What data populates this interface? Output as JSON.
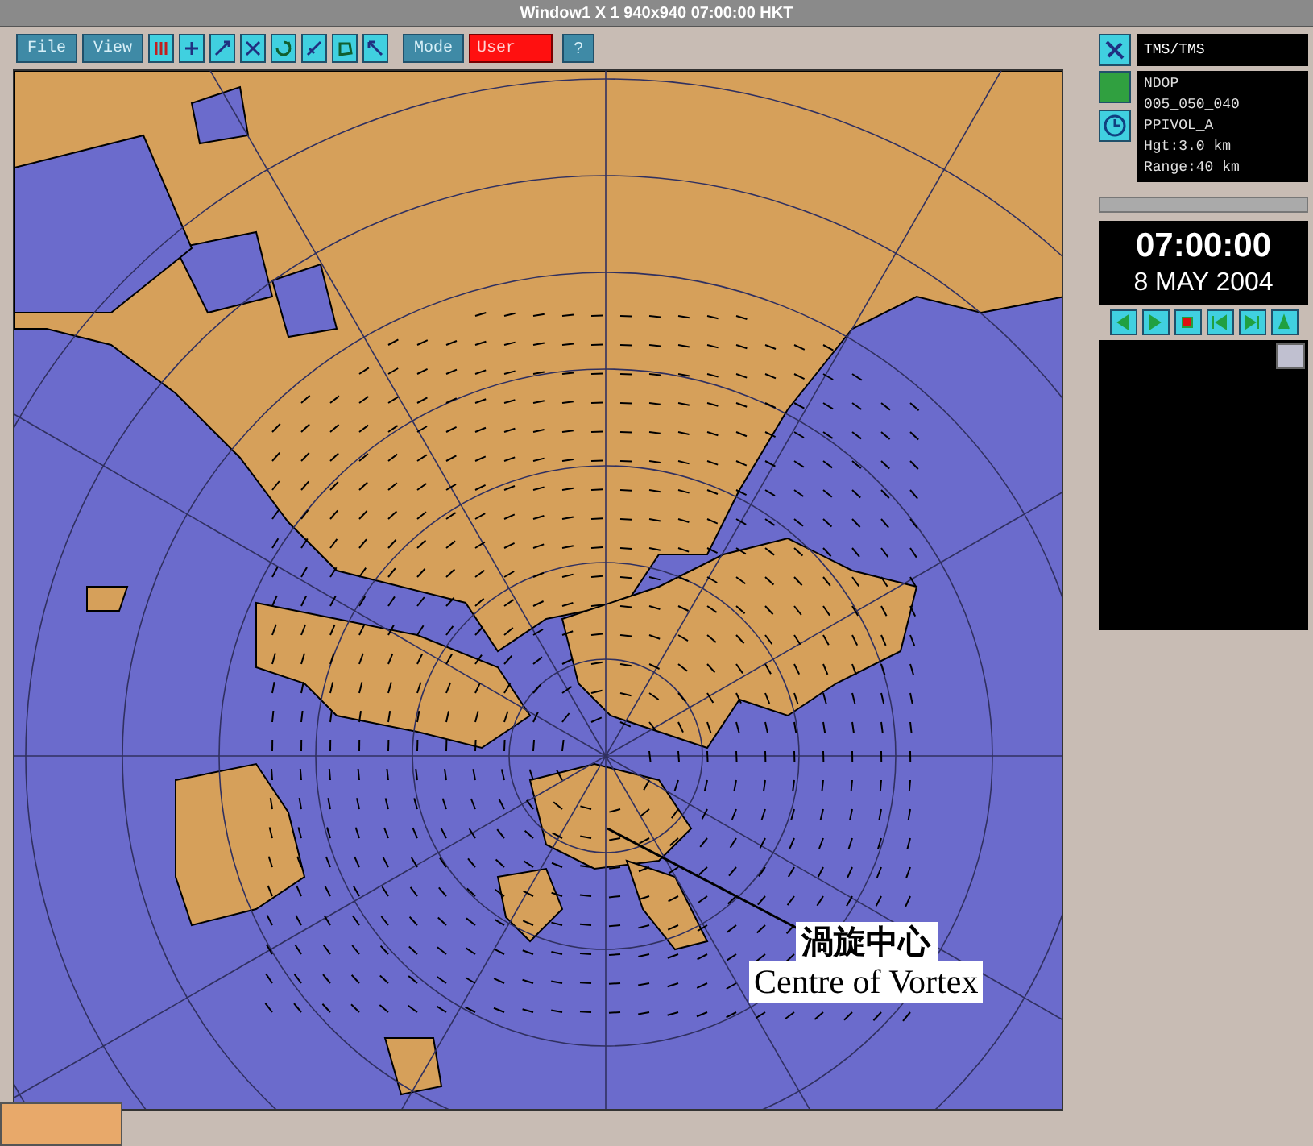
{
  "window": {
    "title": "Window1 X 1 940x940 07:00:00 HKT"
  },
  "toolbar": {
    "menus": [
      {
        "label": "File"
      },
      {
        "label": "View"
      }
    ],
    "tools": [
      {
        "kind": "colors"
      },
      {
        "kind": "pan"
      },
      {
        "kind": "zoom_in"
      },
      {
        "kind": "zoom_out"
      },
      {
        "kind": "rotate"
      },
      {
        "kind": "measure"
      },
      {
        "kind": "overlay"
      },
      {
        "kind": "pointer"
      }
    ],
    "mode_button": {
      "label": "Mode"
    },
    "user_field": {
      "value": "User"
    },
    "help_button": {
      "label": "?"
    }
  },
  "side_panel": {
    "source": "TMS/TMS",
    "product_lines": [
      "NDOP",
      "005_050_040",
      "PPIVOL_A",
      "Hgt:3.0 km",
      "Range:40 km"
    ],
    "time": "07:00:00",
    "date": "8 MAY 2004"
  },
  "annotation": {
    "label_chinese": "渦旋中心",
    "label_english": "Centre of Vortex"
  }
}
